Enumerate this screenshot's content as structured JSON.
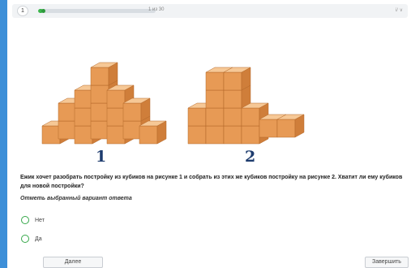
{
  "header": {
    "question_number": "1",
    "progress_fraction": 0.04,
    "counter_text": "1 из 30",
    "corner_text": "i/ ∨"
  },
  "figure": {
    "label_1": "1",
    "label_2": "2"
  },
  "question": {
    "text": "Ежик хочет разобрать постройку из кубиков на рисунке 1 и собрать из этих же кубиков постройку на рисунке 2. Хватит ли ему кубиков для новой постройки?",
    "hint": "Отметь выбранный вариант ответа"
  },
  "options": [
    {
      "label": "Нет"
    },
    {
      "label": "Да"
    }
  ],
  "footer": {
    "next_label": "Далее",
    "finish_label": "Завершить"
  },
  "colors": {
    "accent": "#3ab54a",
    "sidebar": "#3d8fd8",
    "cube_top": "#f6c896",
    "cube_left": "#e79a55",
    "cube_right": "#cf7e3a"
  }
}
